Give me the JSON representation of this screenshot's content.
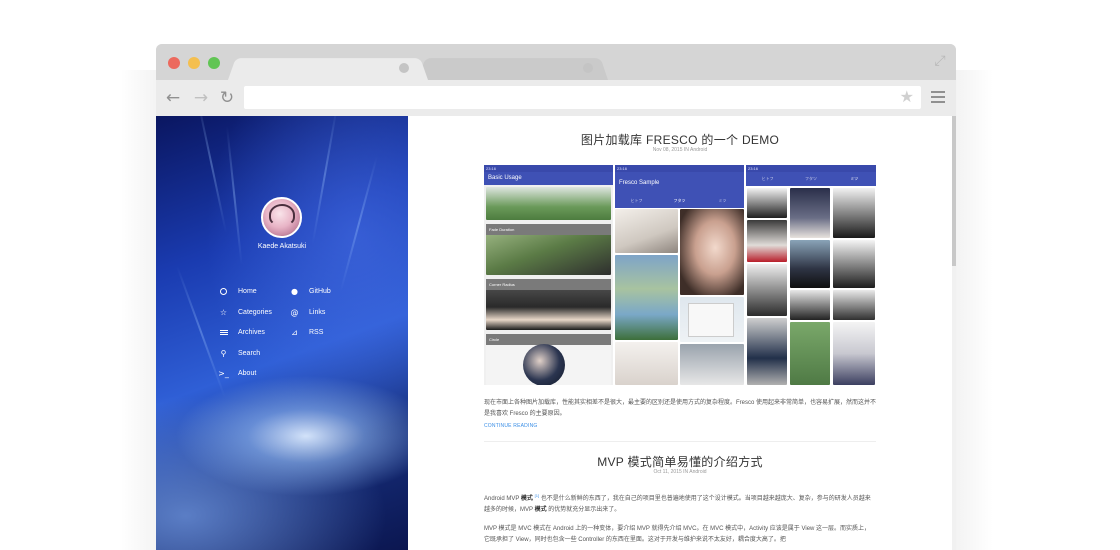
{
  "browser": {
    "address_value": "",
    "icons": [
      "back-arrow-icon",
      "forward-arrow-icon",
      "reload-icon",
      "star-icon",
      "hamburger-menu-icon",
      "expand-icon"
    ]
  },
  "sidebar": {
    "author": "Kaede Akatsuki",
    "nav_left": [
      {
        "label": "Home",
        "icon": "circle-icon"
      },
      {
        "label": "Categories",
        "icon": "star-outline-icon"
      },
      {
        "label": "Archives",
        "icon": "list-icon"
      },
      {
        "label": "Search",
        "icon": "search-icon"
      },
      {
        "label": "About",
        "icon": "terminal-icon"
      }
    ],
    "nav_right": [
      {
        "label": "GitHub",
        "icon": "github-icon"
      },
      {
        "label": "Links",
        "icon": "at-icon"
      },
      {
        "label": "RSS",
        "icon": "rss-icon"
      }
    ]
  },
  "posts": [
    {
      "title": "图片加载库 FRESCO 的一个 DEMO",
      "meta": "Nov 08, 2015 IN Android",
      "screens": [
        {
          "appbar": "Basic Usage",
          "captions": [
            "Fade Duration",
            "Corner Radius",
            "Circle"
          ]
        },
        {
          "appbar": "Fresco Sample",
          "tabs": [
            "ヒトフ",
            "フタツ",
            "ミツ"
          ]
        },
        {
          "tabs": [
            "ヒトフ",
            "フタツ",
            "ミツ"
          ]
        }
      ],
      "excerpt": "现在市面上各种图片加载库，性能其实相差不是很大，最主要的区别还是使用方式的复杂程度。Fresco 使用起来非常简单，也容易扩展，然而这并不是我喜欢 Fresco 的主要原因。",
      "read_more": "CONTINUE READING"
    },
    {
      "title": "MVP 模式简单易懂的介绍方式",
      "meta": "Oct 11, 2015 IN Android",
      "para1_a": "Android MVP ",
      "para1_b": "模式",
      "para1_sup": "[1]",
      "para1_c": " 也不是什么新鲜的东西了，我在自己的项目里也普遍地使用了这个设计模式。当项目越来越庞大、复杂，参与的研发人员越来越多的时候，MVP ",
      "para1_d": "模式",
      "para1_e": " 的优势就充分显示出来了。",
      "para2": "MVP 模式是 MVC 模式在 Android 上的一种变体，要介绍 MVP 就得先介绍 MVC。在 MVC 模式中，Activity 应该是属于 View 这一层。而实质上，它既承担了 View，同时也包含一些 Controller 的东西在里面。这对于开发与维护来说不太友好，耦合度大高了。把"
    }
  ],
  "colors": {
    "accent_link": "#3a8ee6",
    "android_appbar": "#3f51b5",
    "android_statusbar": "#3949ab",
    "mac_red": "#ec6a5e",
    "mac_yellow": "#f4bf4f",
    "mac_green": "#61c554"
  }
}
